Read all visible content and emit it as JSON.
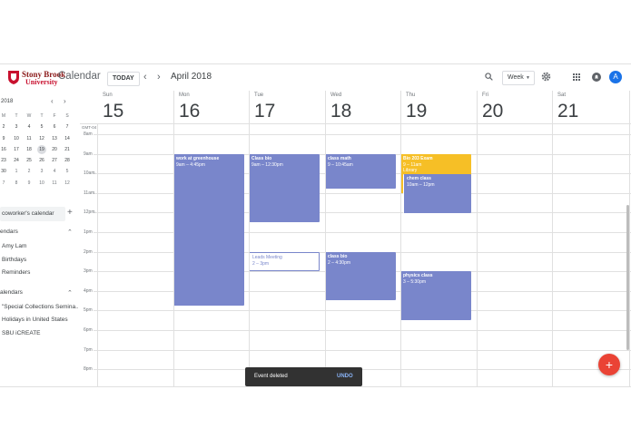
{
  "header": {
    "logo_line1": "Stony Brook",
    "logo_line2": "University",
    "app_title": "Calendar",
    "today_label": "TODAY",
    "prev_glyph": "‹",
    "next_glyph": "›",
    "month_title": "April 2018",
    "view_label": "Week",
    "avatar_letter": "A"
  },
  "mini_calendar": {
    "title": "2018",
    "prev_glyph": "‹",
    "next_glyph": "›",
    "weekday_heads": [
      "M",
      "T",
      "W",
      "T",
      "F",
      "S"
    ],
    "rows": [
      [
        "2",
        "3",
        "4",
        "5",
        "6",
        "7"
      ],
      [
        "9",
        "10",
        "11",
        "12",
        "13",
        "14"
      ],
      [
        "16",
        "17",
        "18",
        "19",
        "20",
        "21"
      ],
      [
        "23",
        "24",
        "25",
        "26",
        "27",
        "28"
      ],
      [
        "30",
        "1",
        "2",
        "3",
        "4",
        "5"
      ],
      [
        "7",
        "8",
        "9",
        "10",
        "11",
        "12"
      ]
    ],
    "selected": "19"
  },
  "sidebar": {
    "coworker_placeholder": "coworker's calendar",
    "plus_glyph": "+",
    "my_calendars_head": "endars",
    "my_calendars": [
      "Amy Lam",
      "Birthdays",
      "Reminders"
    ],
    "other_calendars_head": "alendars",
    "other_calendars": [
      "\"Special Collections Semina...",
      "Holidays in United States",
      "SBU iCREATE"
    ]
  },
  "week": {
    "timezone": "GMT-04",
    "days": [
      {
        "name": "Sun",
        "num": "15"
      },
      {
        "name": "Mon",
        "num": "16"
      },
      {
        "name": "Tue",
        "num": "17"
      },
      {
        "name": "Wed",
        "num": "18"
      },
      {
        "name": "Thu",
        "num": "19"
      },
      {
        "name": "Fri",
        "num": "20"
      },
      {
        "name": "Sat",
        "num": "21"
      }
    ],
    "hours": [
      "8am",
      "9am",
      "10am",
      "11am",
      "12pm",
      "1pm",
      "2pm",
      "3pm",
      "4pm",
      "5pm",
      "6pm",
      "7pm",
      "8pm"
    ]
  },
  "events": {
    "work_greenhouse": {
      "title": "work at greenhouse",
      "time": "9am – 4:45pm"
    },
    "class_bio_tue": {
      "title": "Class bio",
      "time": "9am – 12:30pm"
    },
    "leads_meeting": {
      "title": "Leads Meeting",
      "time": "2 – 3pm"
    },
    "class_math": {
      "title": "class math",
      "time": "9 – 10:45am"
    },
    "class_bio_wed": {
      "title": "class bio",
      "time": "2 – 4:30pm"
    },
    "bio_exam": {
      "title": "Bio 203 Exam",
      "time": "9 – 11am",
      "extra": "Library"
    },
    "chem_class": {
      "title": "chem class",
      "time": "10am – 12pm"
    },
    "physics_class": {
      "title": "physics class",
      "time": "3 – 5:30pm"
    }
  },
  "toast": {
    "message": "Event deleted",
    "action": "UNDO"
  },
  "fab_glyph": "+",
  "colors": {
    "event": "#7986cb",
    "exam": "#f6bf26",
    "fab": "#ea4335",
    "avatar": "#1a73e8"
  }
}
